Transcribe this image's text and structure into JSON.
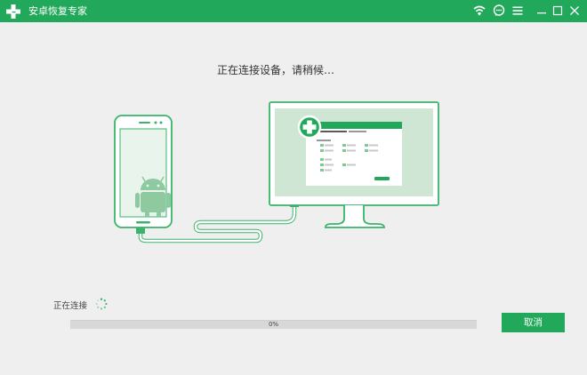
{
  "window": {
    "title": "安卓恢复专家"
  },
  "main": {
    "heading": "正在连接设备，请稍候…",
    "status_label": "正在连接",
    "progress": {
      "value_percent": 0,
      "text": "0%"
    },
    "cancel_label": "取消"
  },
  "colors": {
    "brand": "#22a85a",
    "illustration_light": "#cfe6d5",
    "illustration_stroke": "#3bb36a"
  },
  "icons": {
    "logo": "green-plus-logo",
    "titlebar": [
      "wifi-icon",
      "chat-icon",
      "menu-icon",
      "minimize-icon",
      "maximize-icon",
      "close-icon"
    ]
  }
}
